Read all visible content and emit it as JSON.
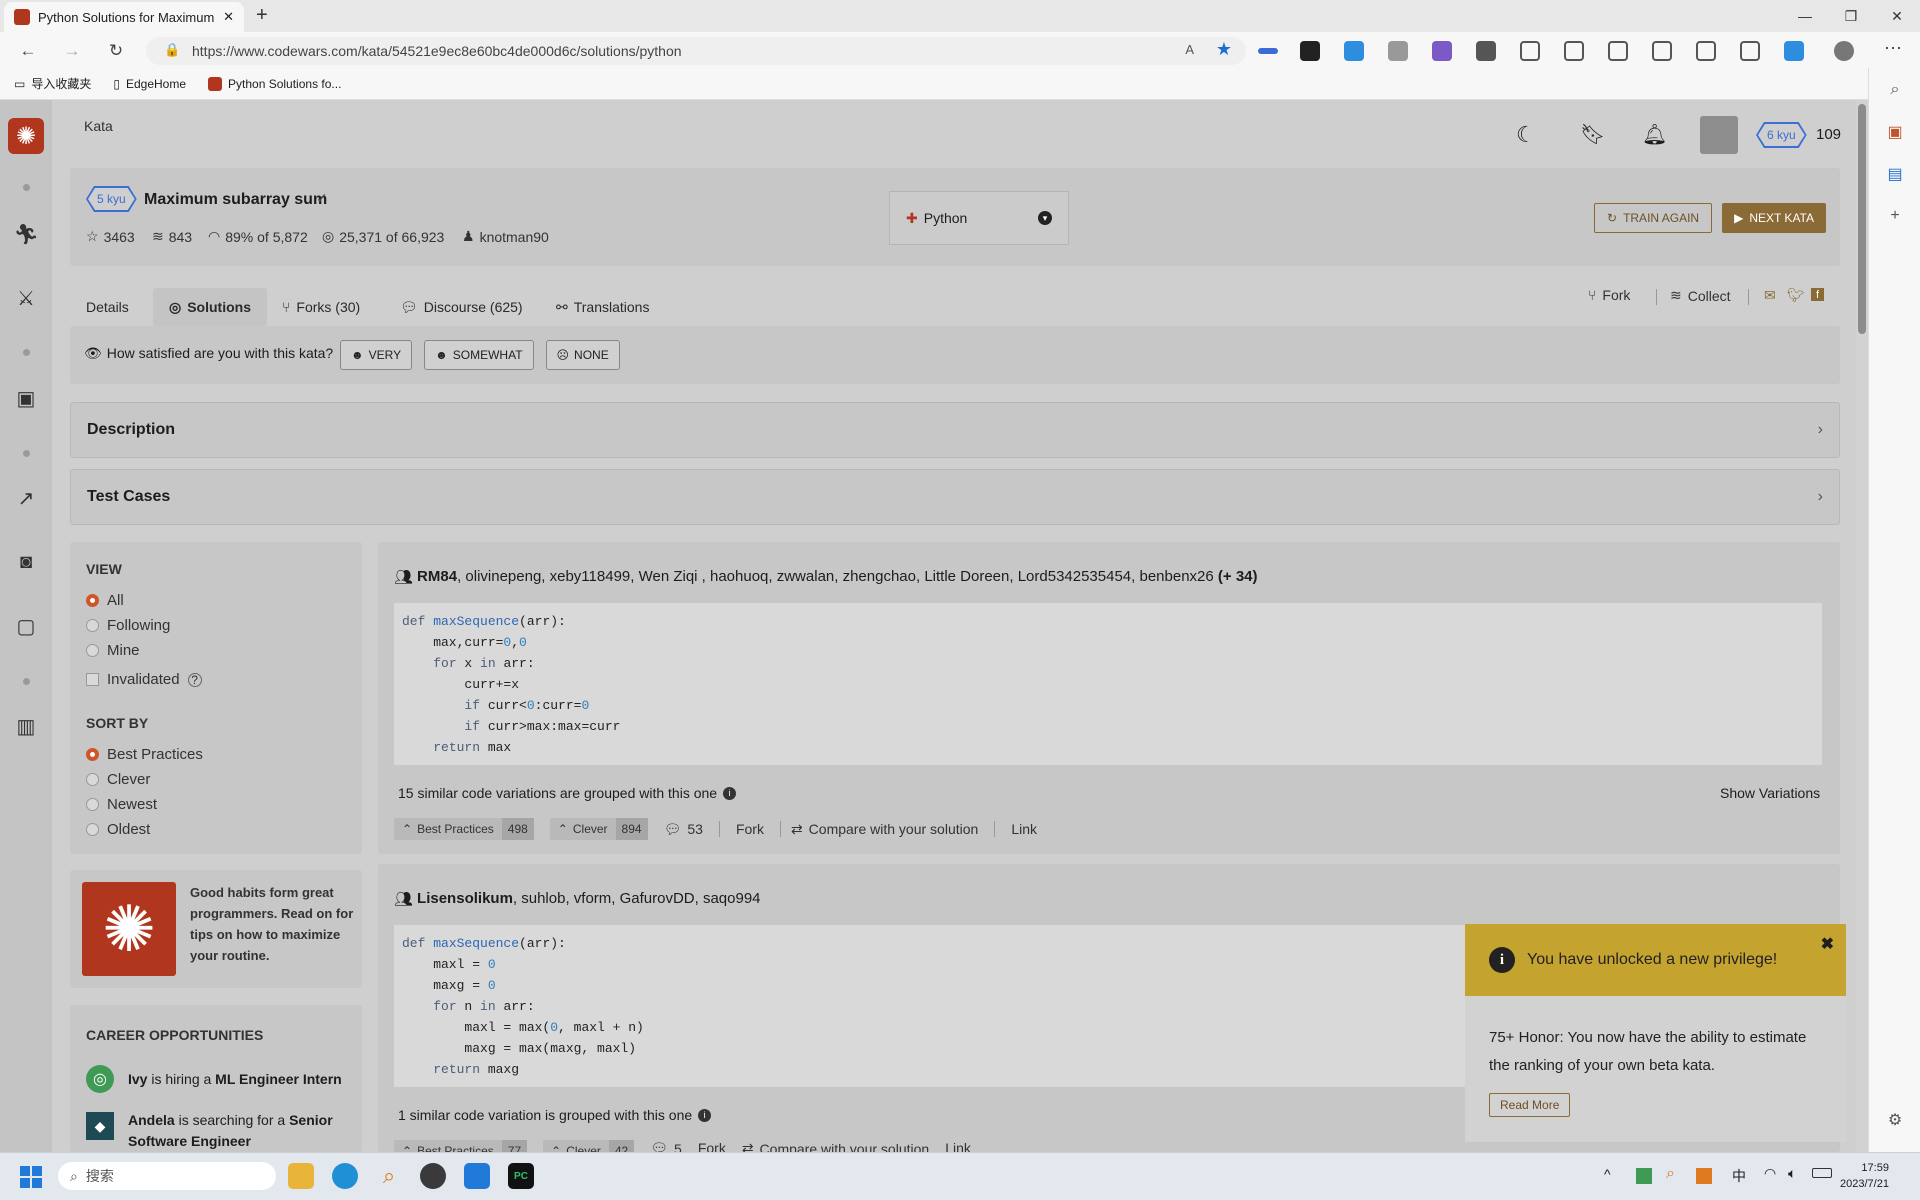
{
  "browser": {
    "tab_title": "Python Solutions for Maximum s",
    "url": "https://www.codewars.com/kata/54521e9ec8e60bc4de000d6c/solutions/python",
    "bookmarks": [
      "导入收藏夹",
      "EdgeHome",
      "Python Solutions fo..."
    ]
  },
  "header": {
    "section": "Kata",
    "rank": "6 kyu",
    "honor": "109"
  },
  "kata": {
    "rank": "5 kyu",
    "title": "Maximum subarray sum",
    "stars": "3463",
    "collections": "843",
    "satisfaction": "89% of 5,872",
    "completed": "25,371 of 66,923",
    "author": "knotman90",
    "language": "Python",
    "train_again": "TRAIN AGAIN",
    "next_kata": "NEXT KATA"
  },
  "tabs": [
    {
      "label": "Details"
    },
    {
      "label": "Solutions"
    },
    {
      "label": "Forks (30)"
    },
    {
      "label": "Discourse (625)"
    },
    {
      "label": "Translations"
    }
  ],
  "tab_actions": {
    "fork": "Fork",
    "collect": "Collect"
  },
  "satisfaction_bar": {
    "question": "How satisfied are you with this kata?",
    "very": "VERY",
    "somewhat": "SOMEWHAT",
    "none": "NONE"
  },
  "sections": {
    "description": "Description",
    "test_cases": "Test Cases"
  },
  "filters": {
    "view_title": "VIEW",
    "view_options": [
      "All",
      "Following",
      "Mine"
    ],
    "invalidated": "Invalidated",
    "sort_title": "SORT BY",
    "sort_options": [
      "Best Practices",
      "Clever",
      "Newest",
      "Oldest"
    ]
  },
  "promo": {
    "text": "Good habits form great programmers. Read on for tips on how to maximize your routine."
  },
  "careers": {
    "title": "CAREER OPPORTUNITIES",
    "job1": {
      "company": "Ivy",
      "mid": " is hiring a ",
      "role": "ML Engineer Intern"
    },
    "job2": {
      "company": "Andela",
      "mid": " is searching for a ",
      "role": "Senior Software Engineer (Python+Zuora)"
    }
  },
  "solution1": {
    "lead": "RM84",
    "authors": ", olivinepeng, xeby118499, Wen Ziqi , haohuoq, zwwalan, zhengchao, Little Doreen, Lord5342535454, benbenx26",
    "more": " (+ 34)",
    "variations": "15 similar code variations are grouped with this one",
    "show_variations": "Show Variations",
    "best_practices": "Best Practices",
    "bp_count": "498",
    "clever": "Clever",
    "clever_count": "894",
    "comments": "53",
    "fork": "Fork",
    "compare": "Compare with your solution",
    "link": "Link"
  },
  "solution2": {
    "lead": "Lisensolikum",
    "authors": ", suhlob, vform, GafurovDD, saqo994",
    "variations": "1 similar code variation is grouped with this one",
    "best_practices": "Best Practices",
    "bp_count": "77",
    "clever": "Clever",
    "clever_count": "42",
    "comments": "5",
    "fork": "Fork",
    "compare": "Compare with your solution",
    "link": "Link"
  },
  "toast": {
    "title": "You have unlocked a new privilege!",
    "body": "75+ Honor: You now have the ability to estimate the ranking of your own beta kata.",
    "button": "Read More"
  },
  "taskbar": {
    "search": "搜索",
    "time": "17:59",
    "date": "2023/7/21",
    "ime": "中"
  },
  "colors": {
    "brand": "#b1361e",
    "accent": "#8a6a35",
    "kyu": "#3c6ed3",
    "radio": "#d1552b",
    "toast_header": "#c5a32f"
  }
}
